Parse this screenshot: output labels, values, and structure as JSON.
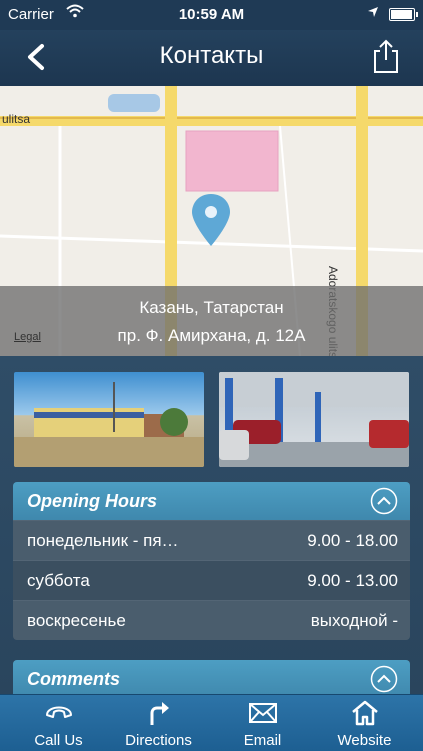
{
  "status_bar": {
    "carrier": "Carrier",
    "time": "10:59 AM"
  },
  "nav": {
    "title": "Контакты"
  },
  "map": {
    "street_top_left": "ulitsa",
    "street_right": "Adoratskogo ulitsa",
    "address_city": "Казань, Татарстан",
    "address_street": "пр. Ф. Амирхана, д. 12А",
    "legal": "Legal"
  },
  "opening_hours": {
    "title": "Opening Hours",
    "rows": [
      {
        "day": "понедельник - пя…",
        "hours": "9.00 - 18.00"
      },
      {
        "day": "суббота",
        "hours": "9.00 - 13.00"
      },
      {
        "day": "воскресенье",
        "hours": "выходной -"
      }
    ]
  },
  "comments": {
    "title": "Comments"
  },
  "tabs": [
    {
      "label": "Call Us",
      "icon": "phone-icon"
    },
    {
      "label": "Directions",
      "icon": "directions-icon"
    },
    {
      "label": "Email",
      "icon": "envelope-icon"
    },
    {
      "label": "Website",
      "icon": "home-icon"
    }
  ],
  "colors": {
    "nav_bg": "#1f3a55",
    "panel_header": "#4d9ec3",
    "tabbar": "#2d74a8",
    "map_pin": "#5ea8d6"
  }
}
